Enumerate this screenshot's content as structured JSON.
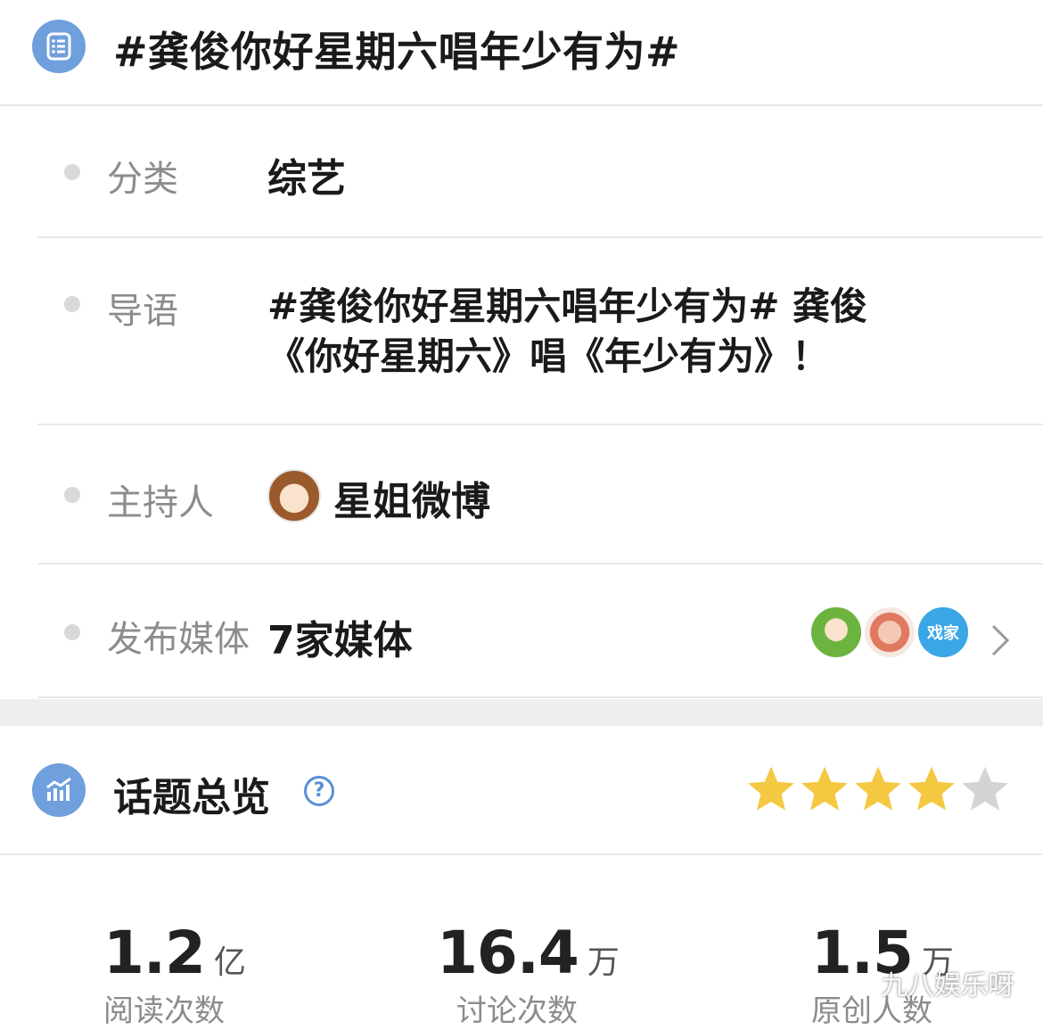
{
  "topic": {
    "title": "#龚俊你好星期六唱年少有为#",
    "icon": "list-doc-icon"
  },
  "details": {
    "category_label": "分类",
    "category_value": "综艺",
    "intro_label": "导语",
    "intro_line1": "#龚俊你好星期六唱年少有为# 龚俊",
    "intro_line2": "《你好星期六》唱《年少有为》！",
    "host_label": "主持人",
    "host_name": "星姐微博",
    "media_label": "发布媒体",
    "media_value": "7家媒体",
    "media_avatar_text": "戏家"
  },
  "overview": {
    "title": "话题总览",
    "help_symbol": "?",
    "rating": 4,
    "rating_max": 5,
    "star_color": "#f5c842",
    "star_empty_color": "#d4d4d4"
  },
  "stats": [
    {
      "value": "1.2",
      "unit": "亿",
      "label": "阅读次数"
    },
    {
      "value": "16.4",
      "unit": "万",
      "label": "讨论次数"
    },
    {
      "value": "1.5",
      "unit": "万",
      "label": "原创人数"
    }
  ],
  "watermark": "九八娱乐呀",
  "colors": {
    "accent": "#6f9fdc",
    "link": "#5a8fd8"
  }
}
